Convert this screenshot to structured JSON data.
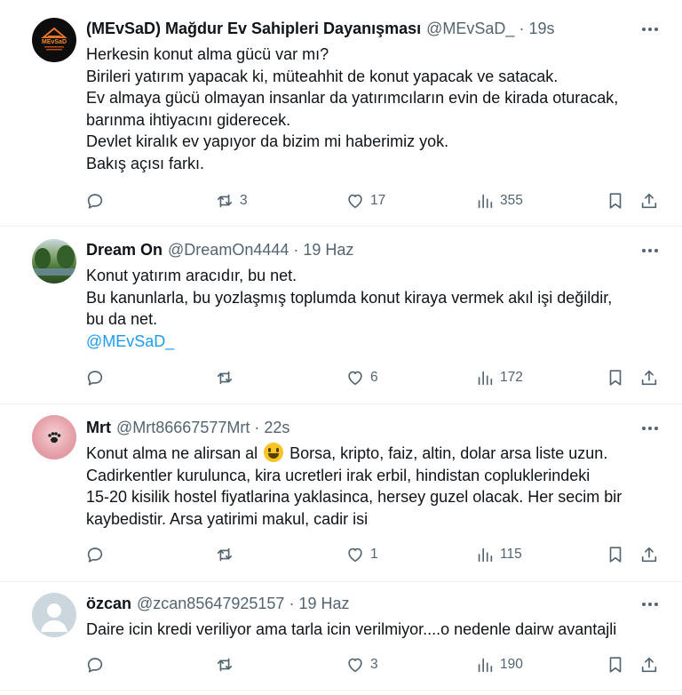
{
  "tweets": [
    {
      "name": "(MEvSaD) Mağdur Ev Sahipleri Dayanışması",
      "handle": "@MEvSaD_",
      "sep": "·",
      "time": "19s",
      "avatar_text": "MEvSaD",
      "lines": [
        "Herkesin konut alma gücü var mı?",
        "Birileri yatırım yapacak ki, müteahhit  de konut yapacak ve satacak.",
        "Ev almaya gücü olmayan insanlar da yatırımcıların evin de kirada oturacak,",
        "barınma ihtiyacını giderecek.",
        "Devlet kiralık ev yapıyor da bizim mi haberimiz yok.",
        "Bakış açısı farkı."
      ],
      "replies": "",
      "retweets": "3",
      "likes": "17",
      "views": "355"
    },
    {
      "name": "Dream On",
      "handle": "@DreamOn4444",
      "sep": "·",
      "time": "19 Haz",
      "lines": [
        "Konut yatırım aracıdır, bu net.",
        "Bu kanunlarla, bu yozlaşmış toplumda konut kiraya vermek akıl işi değildir,",
        "bu da net."
      ],
      "mention": "@MEvSaD_",
      "replies": "",
      "retweets": "",
      "likes": "6",
      "views": "172"
    },
    {
      "name": "Mrt",
      "handle": "@Mrt86667577Mrt",
      "sep": "·",
      "time": "22s",
      "line1_before": "Konut alma ne alirsan al",
      "line1_after": "Borsa, kripto, faiz, altin, dolar arsa liste uzun.",
      "lines": [
        "Cadirkentler kurulunca, kira ucretleri irak erbil, hindistan copluklerindeki",
        "15-20 kisilik hostel fiyatlarina yaklasinca, hersey guzel olacak. Her secim bir",
        "kaybedistir. Arsa yatirimi makul, cadir isi"
      ],
      "replies": "",
      "retweets": "",
      "likes": "1",
      "views": "115"
    },
    {
      "name": "özcan",
      "handle": "@zcan85647925157",
      "sep": "·",
      "time": "19 Haz",
      "lines": [
        "Daire icin kredi veriliyor ama tarla icin verilmiyor....o nedenle dairw avantajli"
      ],
      "replies": "",
      "retweets": "",
      "likes": "3",
      "views": "190"
    }
  ],
  "colors": {
    "text": "#0f1419",
    "secondary": "#536471",
    "link": "#1d9bf0",
    "divider": "#eff3f4"
  },
  "icons": [
    "more-icon",
    "reply-icon",
    "retweet-icon",
    "like-icon",
    "views-icon",
    "bookmark-icon",
    "share-icon"
  ]
}
